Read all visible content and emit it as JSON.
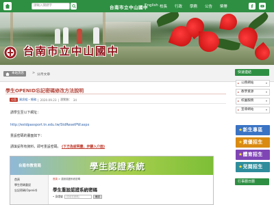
{
  "topbar": {
    "search_placeholder": "請輸入關鍵字",
    "site_title": "台南市立中山國中",
    "links": [
      "English",
      "校長",
      "行政",
      "學務",
      "公告",
      "榮譽"
    ],
    "social": [
      "facebook-icon",
      "youtube-icon"
    ]
  },
  "banner": {
    "school_name": "台南市立中山國中"
  },
  "breadcrumb": {
    "home_label": "本站消息",
    "separator": ">",
    "current": "分月文章"
  },
  "article": {
    "title": "學生OPENID忘記密碼修改方法說明",
    "tag": "公告",
    "author": "資訊組・總務",
    "date": "2020.09.23",
    "views_label": "瀏覽數：",
    "views": "34",
    "para1": "請學生至以下網址：",
    "url": "http://estdpassport.tn.edu.tw/StdResetPW.aspx",
    "para2": "重設密碼的畫面如下：",
    "para3_prefix": "請填妥所有資料，即可重設密碼。",
    "para3_link": "(下方為就明畫，步驟入介面)"
  },
  "embedded": {
    "logo_text": "台南市教育局",
    "title": "學生認證系統",
    "side": [
      "首頁",
      "學生密碼重設",
      "忘記密碼(Openid)"
    ],
    "crumb_home": "首頁",
    "crumb_current": "重設認證系統密碼",
    "heading": "學生重設認證系統密碼",
    "field_label": "• 身證號",
    "field_placeholder": "(須填寫號碼)",
    "button": "確認"
  },
  "sidebar": {
    "links_head": "快速連結",
    "links": [
      "公務網站",
      "教學資源",
      "校園服務",
      "宣導網站"
    ],
    "promos": [
      {
        "label": "新生專區",
        "color": "#3a73c4"
      },
      {
        "label": "資優招生",
        "color": "#d98a12"
      },
      {
        "label": "體育招生",
        "color": "#7f45b5"
      },
      {
        "label": "兒閱招生",
        "color": "#2f8d9c"
      }
    ],
    "calendar_head": "行事曆日曆"
  },
  "colors": {
    "brand_green": "#2e8f43",
    "title_red": "#b5473c",
    "school_name": "#8a0f16"
  }
}
